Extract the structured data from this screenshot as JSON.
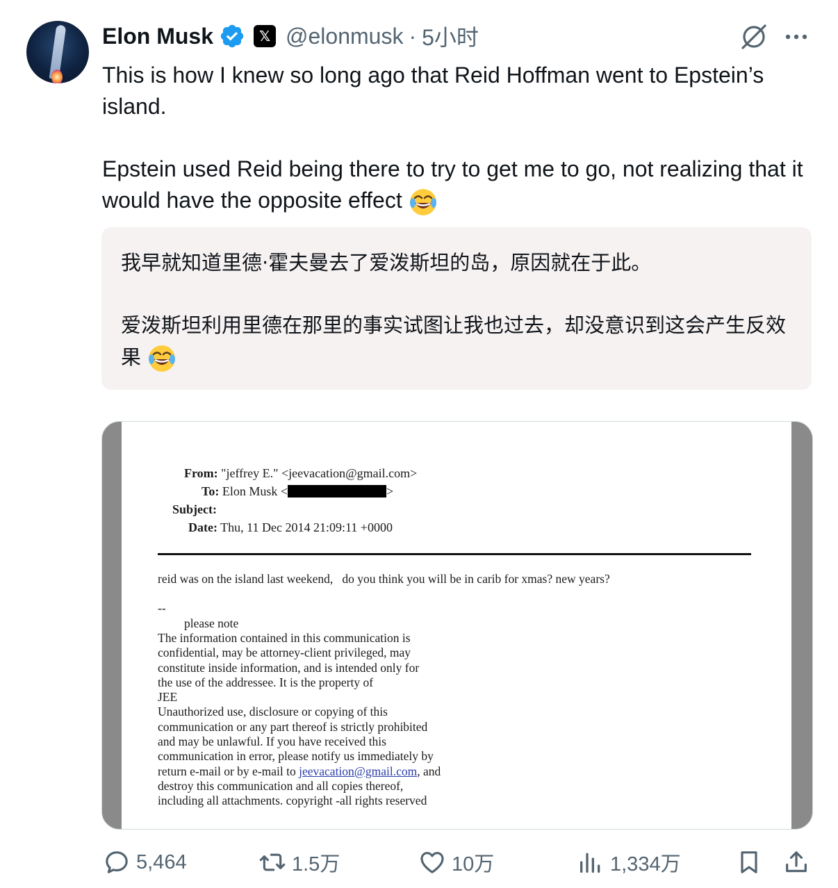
{
  "author": {
    "name": "Elon Musk",
    "handle": "@elonmusk",
    "separator": "·",
    "time": "5小时"
  },
  "tweet": {
    "paragraph1": "This is how I knew so long ago that Reid Hoffman went to Epstein’s island.",
    "paragraph2": "Epstein used Reid being there to try to get me to go, not realizing that it would have the opposite effect"
  },
  "translation": {
    "paragraph1": "我早就知道里德·霍夫曼去了爱泼斯坦的岛，原因就在于此。",
    "paragraph2": "爱泼斯坦利用里德在那里的事实试图让我也过去，却没意识到这会产生反效果"
  },
  "email": {
    "from_label": "From:",
    "from_value": "\"jeffrey E.\" <jeevacation@gmail.com>",
    "to_label": "To:",
    "to_value": "Elon Musk <",
    "to_close": ">",
    "subject_label": "Subject:",
    "date_label": "Date:",
    "date_value": "Thu, 11 Dec 2014 21:09:11 +0000",
    "message": "reid was on the island last weekend,   do you think you will be in carib for xmas? new years?",
    "dashes": "--",
    "notice_title": "please note",
    "lines": [
      "The information contained in this communication is",
      "confidential, may be attorney-client privileged, may",
      "constitute inside information, and is intended only for",
      "the use of the addressee. It is the property of",
      "JEE",
      "Unauthorized use, disclosure or copying of this",
      "communication or any part thereof is strictly prohibited",
      "and may be unlawful. If you have received this",
      "communication in error, please notify us immediately by"
    ],
    "return_line_pre": "return e-mail or by e-mail to ",
    "return_line_link": "jeevacation@gmail.com",
    "return_line_post": ", and",
    "tail_lines": [
      "destroy this communication and all copies thereof,",
      "including all attachments. copyright -all rights reserved"
    ]
  },
  "actions": {
    "replies": "5,464",
    "reposts": "1.5万",
    "likes": "10万",
    "views": "1,334万"
  },
  "colors": {
    "verified": "#1d9bf0",
    "secondary_text": "#536471",
    "translation_bg": "#f7f2f2"
  },
  "icons": [
    "verified-badge-icon",
    "x-affiliate-icon",
    "grok-icon",
    "more-icon",
    "laughing-emoji-icon",
    "reply-icon",
    "repost-icon",
    "like-icon",
    "views-icon",
    "bookmark-icon",
    "share-icon"
  ]
}
